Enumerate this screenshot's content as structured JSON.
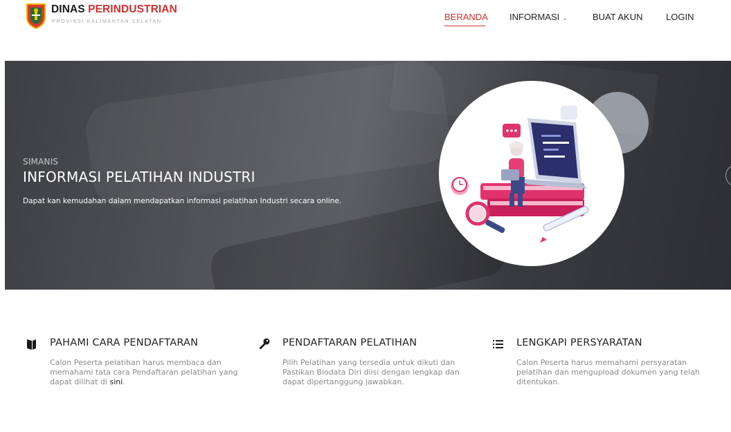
{
  "brand": {
    "title_main": "DINAS ",
    "title_accent": "PERINDUSTRIAN",
    "subtitle": "PROVINSI KALIMANTAN SELATAN"
  },
  "nav": {
    "items": [
      {
        "label": "BERANDA",
        "active": true
      },
      {
        "label": "INFORMASI",
        "has_dropdown": true
      },
      {
        "label": "BUAT AKUN"
      },
      {
        "label": "LOGIN"
      }
    ]
  },
  "hero": {
    "eyebrow": "SIMANIS",
    "title": "INFORMASI PELATIHAN INDUSTRI",
    "description": "Dapat kan kemudahan dalam mendapatkan informasi pelatihan Industri secara online."
  },
  "features": [
    {
      "icon": "book-icon",
      "title": "PAHAMI CARA PENDAFTARAN",
      "text_before_link": "Calon Peserta pelatihan harus membaca dan memahami tata cara Pendaftaran pelatihan yang dapat dilihat di ",
      "link_label": "sini",
      "text_after_link": "."
    },
    {
      "icon": "key-icon",
      "title": "PENDAFTARAN PELATIHAN",
      "text": "Pilih Pelatihan yang tersedia untuk dikuti dan Pastikan Biodata Diri diisi dengan lengkap dan dapat dipertanggung jawabkan."
    },
    {
      "icon": "list-icon",
      "title": "LENGKAPI PERSYARATAN",
      "text": "Calon Peserta harus memahami persyaratan pelatihan dan mengupload dokumen yang telah ditentukan."
    }
  ],
  "colors": {
    "accent": "#d32f2f",
    "hero_bg": "#4f5054",
    "illustration_pink": "#e0336e",
    "illustration_navy": "#2b2f6b"
  }
}
